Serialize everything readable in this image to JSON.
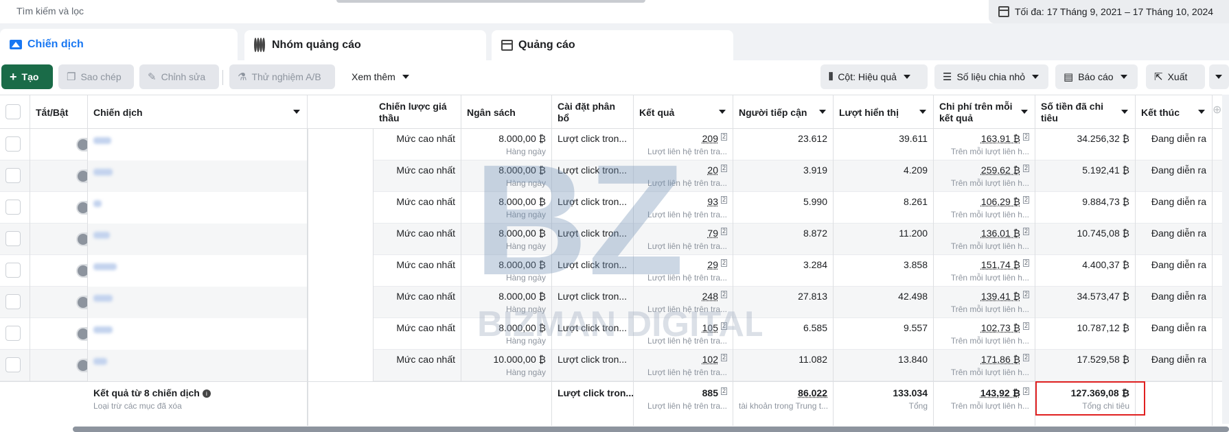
{
  "search": {
    "placeholder": "Tìm kiếm và lọc"
  },
  "date_range": {
    "label": "Tối đa: 17 Tháng 9, 2021 – 17 Tháng 10, 2024"
  },
  "tabs": [
    {
      "label": "Chiến dịch"
    },
    {
      "label": "Nhóm quảng cáo"
    },
    {
      "label": "Quảng cáo"
    }
  ],
  "toolbar": {
    "create": "Tạo",
    "copy": "Sao chép",
    "edit": "Chỉnh sửa",
    "ab_test": "Thử nghiệm A/B",
    "more": "Xem thêm",
    "columns": "Cột: Hiệu quả",
    "breakdown": "Số liệu chia nhỏ",
    "report": "Báo cáo",
    "export": "Xuất"
  },
  "headers": {
    "toggle": "Tắt/Bật",
    "campaign": "Chiến dịch",
    "bid_strategy": "Chiến lược giá thầu",
    "budget": "Ngân sách",
    "attribution": "Cài đặt phân bổ",
    "results": "Kết quả",
    "reach": "Người tiếp cận",
    "impressions": "Lượt hiển thị",
    "cost_per_result": "Chi phí trên mỗi kết quả",
    "amount_spent": "Số tiền đã chi tiêu",
    "ends": "Kết thúc"
  },
  "rows": [
    {
      "bid": "Mức cao nhất",
      "budget": "8.000,00 ₿",
      "budget_sub": "Hàng ngày",
      "attribution": "Lượt click tron...",
      "results": "209",
      "results_sub": "Lượt liên hệ trên tra...",
      "reach": "23.612",
      "impressions": "39.611",
      "cpr": "163,91 ₿",
      "cpr_sub": "Trên mỗi lượt liên h...",
      "spent": "34.256,32 ₿",
      "ends": "Đang diễn ra"
    },
    {
      "bid": "Mức cao nhất",
      "budget": "8.000,00 ₿",
      "budget_sub": "Hàng ngày",
      "attribution": "Lượt click tron...",
      "results": "20",
      "results_sub": "Lượt liên hệ trên tra...",
      "reach": "3.919",
      "impressions": "4.209",
      "cpr": "259,62 ₿",
      "cpr_sub": "Trên mỗi lượt liên h...",
      "spent": "5.192,41 ₿",
      "ends": "Đang diễn ra"
    },
    {
      "bid": "Mức cao nhất",
      "budget": "8.000,00 ₿",
      "budget_sub": "Hàng ngày",
      "attribution": "Lượt click tron...",
      "results": "93",
      "results_sub": "Lượt liên hệ trên tra...",
      "reach": "5.990",
      "impressions": "8.261",
      "cpr": "106,29 ₿",
      "cpr_sub": "Trên mỗi lượt liên h...",
      "spent": "9.884,73 ₿",
      "ends": "Đang diễn ra"
    },
    {
      "bid": "Mức cao nhất",
      "budget": "8.000,00 ₿",
      "budget_sub": "Hàng ngày",
      "attribution": "Lượt click tron...",
      "results": "79",
      "results_sub": "Lượt liên hệ trên tra...",
      "reach": "8.872",
      "impressions": "11.200",
      "cpr": "136,01 ₿",
      "cpr_sub": "Trên mỗi lượt liên h...",
      "spent": "10.745,08 ₿",
      "ends": "Đang diễn ra"
    },
    {
      "bid": "Mức cao nhất",
      "budget": "8.000,00 ₿",
      "budget_sub": "Hàng ngày",
      "attribution": "Lượt click tron...",
      "results": "29",
      "results_sub": "Lượt liên hệ trên tra...",
      "reach": "3.284",
      "impressions": "3.858",
      "cpr": "151,74 ₿",
      "cpr_sub": "Trên mỗi lượt liên h...",
      "spent": "4.400,37 ₿",
      "ends": "Đang diễn ra"
    },
    {
      "bid": "Mức cao nhất",
      "budget": "8.000,00 ₿",
      "budget_sub": "Hàng ngày",
      "attribution": "Lượt click tron...",
      "results": "248",
      "results_sub": "Lượt liên hệ trên tra...",
      "reach": "27.813",
      "impressions": "42.498",
      "cpr": "139,41 ₿",
      "cpr_sub": "Trên mỗi lượt liên h...",
      "spent": "34.573,47 ₿",
      "ends": "Đang diễn ra"
    },
    {
      "bid": "Mức cao nhất",
      "budget": "8.000,00 ₿",
      "budget_sub": "Hàng ngày",
      "attribution": "Lượt click tron...",
      "results": "105",
      "results_sub": "Lượt liên hệ trên tra...",
      "reach": "6.585",
      "impressions": "9.557",
      "cpr": "102,73 ₿",
      "cpr_sub": "Trên mỗi lượt liên h...",
      "spent": "10.787,12 ₿",
      "ends": "Đang diễn ra"
    },
    {
      "bid": "Mức cao nhất",
      "budget": "10.000,00 ₿",
      "budget_sub": "Hàng ngày",
      "attribution": "Lượt click tron...",
      "results": "102",
      "results_sub": "Lượt liên hệ trên tra...",
      "reach": "11.082",
      "impressions": "13.840",
      "cpr": "171,86 ₿",
      "cpr_sub": "Trên mỗi lượt liên h...",
      "spent": "17.529,58 ₿",
      "ends": "Đang diễn ra"
    }
  ],
  "totals": {
    "label": "Kết quả từ 8 chiến dịch",
    "label_sub": "Loại trừ các mục đã xóa",
    "attribution": "Lượt click tron...",
    "results": "885",
    "results_sub": "Lượt liên hệ trên tra...",
    "reach": "86.022",
    "reach_sub": "tài khoản trong Trung t...",
    "impressions": "133.034",
    "impressions_sub": "Tổng",
    "cpr": "143,92 ₿",
    "cpr_sub": "Trên mỗi lượt liên h...",
    "spent": "127.369,08 ₿",
    "spent_sub": "Tổng chi tiêu"
  },
  "watermark": {
    "line1": "BZ",
    "line2": "BIZMAN DIGITAL"
  },
  "colors": {
    "accent": "#1877f2",
    "create": "#1a6b48",
    "highlight": "#e02020"
  }
}
